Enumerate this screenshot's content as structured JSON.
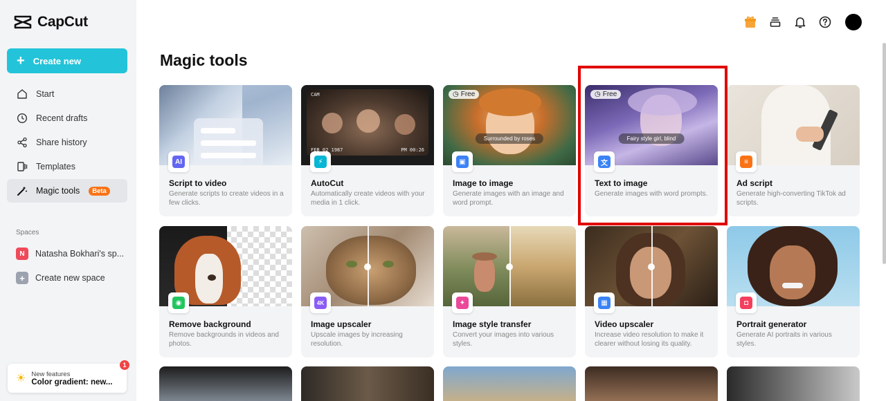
{
  "app": {
    "name": "CapCut"
  },
  "sidebar": {
    "create_label": "Create new",
    "items": [
      {
        "label": "Start",
        "icon": "home-icon"
      },
      {
        "label": "Recent drafts",
        "icon": "clock-icon"
      },
      {
        "label": "Share history",
        "icon": "share-icon"
      },
      {
        "label": "Templates",
        "icon": "templates-icon"
      },
      {
        "label": "Magic tools",
        "icon": "magic-wand-icon",
        "badge": "Beta",
        "active": true
      }
    ],
    "spaces_label": "Spaces",
    "space_name": "Natasha Bokhari's sp...",
    "space_initial": "N",
    "create_space_label": "Create new space",
    "new_features": {
      "small": "New features",
      "big": "Color gradient: new...",
      "badge": "1"
    }
  },
  "header": {
    "icons": [
      "gift-icon",
      "stack-icon",
      "bell-icon",
      "help-icon"
    ]
  },
  "page_title": "Magic tools",
  "free_label": "Free",
  "cards": [
    {
      "title": "Script to video",
      "desc": "Generate scripts to create videos in a few clicks."
    },
    {
      "title": "AutoCut",
      "desc": "Automatically create videos with your media in 1 click."
    },
    {
      "title": "Image to image",
      "desc": "Generate images with an image and word prompt.",
      "prompt": "Surrounded by roses"
    },
    {
      "title": "Text to image",
      "desc": "Generate images with word prompts.",
      "prompt": "Fairy style girl, blind"
    },
    {
      "title": "Ad script",
      "desc": "Generate high-converting TikTok ad scripts."
    },
    {
      "title": "Remove background",
      "desc": "Remove backgrounds in videos and photos."
    },
    {
      "title": "Image upscaler",
      "desc": "Upscale images by increasing resolution."
    },
    {
      "title": "Image style transfer",
      "desc": "Convert your images into various styles."
    },
    {
      "title": "Video upscaler",
      "desc": "Increase video resolution to make it clearer without losing its quality."
    },
    {
      "title": "Portrait generator",
      "desc": "Generate AI portraits in various styles."
    }
  ],
  "autocut_overlay": {
    "top_left": "CAM",
    "bottom_left": "FEB 02 1987",
    "bottom_right": "PM 00:26"
  },
  "colors": {
    "accent": "#23c4d9",
    "highlight": "#e00000",
    "beta": "#f97316"
  }
}
